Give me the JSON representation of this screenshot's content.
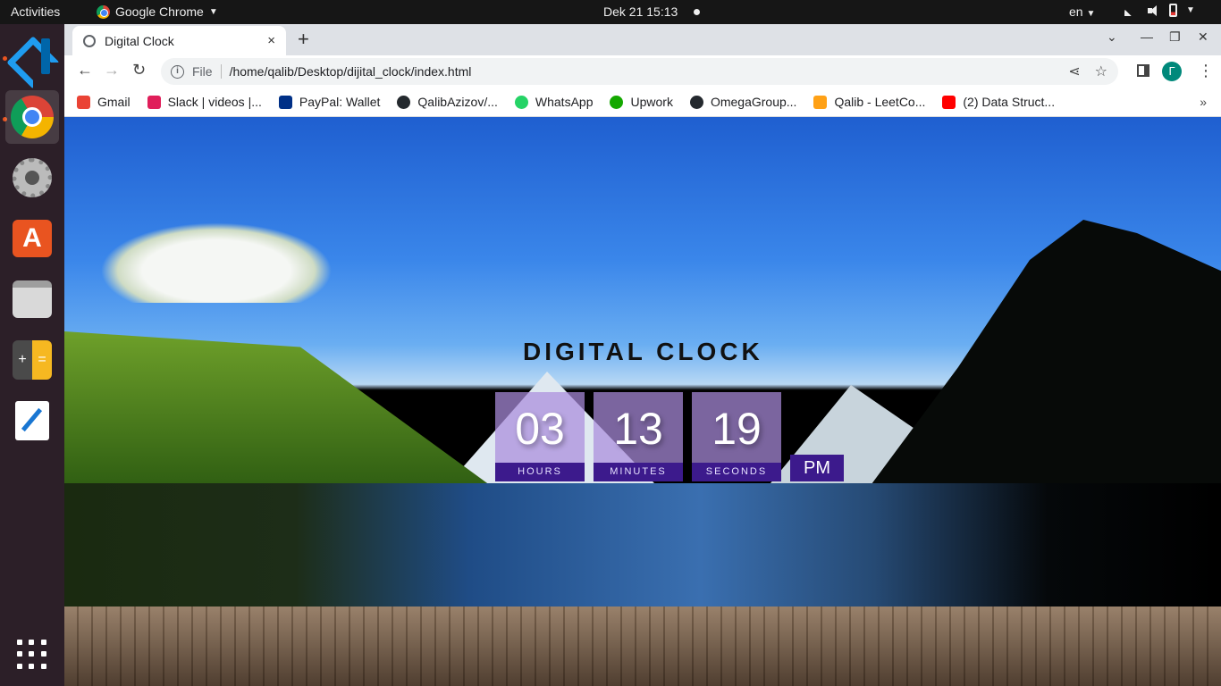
{
  "topbar": {
    "activities": "Activities",
    "app_name": "Google Chrome",
    "datetime": "Dek 21  15:13",
    "language": "en"
  },
  "dock": {
    "items": [
      "vscode-icon",
      "chrome-icon",
      "settings-icon",
      "software-store-icon",
      "files-icon",
      "calculator-icon",
      "text-editor-icon"
    ],
    "show_apps": "show-applications-icon"
  },
  "browser": {
    "tab_title": "Digital Clock",
    "tab_close": "×",
    "new_tab": "+",
    "address_scheme": "File",
    "url": "/home/qalib/Desktop/dijital_clock/index.html",
    "profile_initial": "Г",
    "bookmarks": [
      {
        "label": "Gmail",
        "color": "#ea4335"
      },
      {
        "label": "Slack | videos |...",
        "color": "#e01e5a"
      },
      {
        "label": "PayPal: Wallet",
        "color": "#003087"
      },
      {
        "label": "QalibAzizov/...",
        "color": "#24292e"
      },
      {
        "label": "WhatsApp",
        "color": "#25d366"
      },
      {
        "label": "Upwork",
        "color": "#14a800"
      },
      {
        "label": "OmegaGroup...",
        "color": "#24292e"
      },
      {
        "label": "Qalib - LeetCo...",
        "color": "#ffa116"
      },
      {
        "label": "(2) Data Struct...",
        "color": "#ff0000"
      }
    ],
    "bookmarks_more": "»"
  },
  "page": {
    "title": "DIGITAL CLOCK",
    "hours": "03",
    "minutes": "13",
    "seconds": "19",
    "hours_label": "HOURS",
    "minutes_label": "MINUTES",
    "seconds_label": "SECONDS",
    "ampm": "PM"
  },
  "colors": {
    "clock_box": "#aa8cdc",
    "clock_label_bg": "#3c1a8c",
    "ubuntu_accent": "#e95420"
  }
}
